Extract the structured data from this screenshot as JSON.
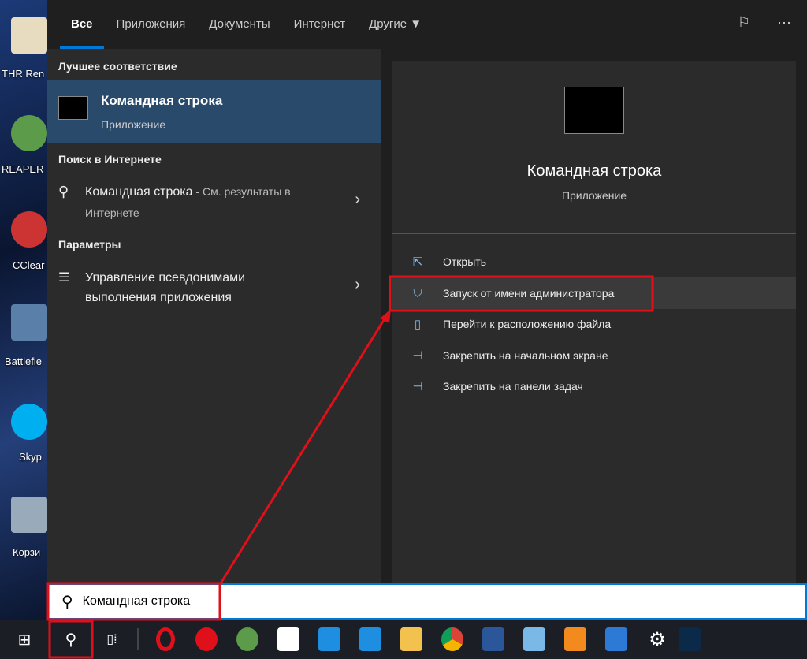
{
  "desktop": {
    "icons": [
      "THR Ren",
      "REAPER",
      "CClear",
      "Battlefie",
      "Skyp",
      "Корзи"
    ]
  },
  "tabs": [
    {
      "label": "Все",
      "active": true
    },
    {
      "label": "Приложения"
    },
    {
      "label": "Документы"
    },
    {
      "label": "Интернет"
    },
    {
      "label": "Другие"
    }
  ],
  "header_icons": [
    "feedback-icon",
    "more-icon"
  ],
  "left": {
    "best_match_heading": "Лучшее соответствие",
    "best_match": {
      "title": "Командная строка",
      "subtitle": "Приложение"
    },
    "web_heading": "Поиск в Интернете",
    "web_item": {
      "query": "Командная строка",
      "suffix": " - См. результаты в",
      "line2": "Интернете"
    },
    "settings_heading": "Параметры",
    "settings_item": {
      "line1": "Управление псевдонимами",
      "line2": "выполнения приложения"
    }
  },
  "right": {
    "title": "Командная строка",
    "subtitle": "Приложение",
    "actions": [
      {
        "label": "Открыть",
        "icon": "open-icon"
      },
      {
        "label": "Запуск от имени администратора",
        "icon": "shield-icon",
        "highlighted": true
      },
      {
        "label": "Перейти к расположению файла",
        "icon": "file-location-icon"
      },
      {
        "label": "Закрепить на начальном экране",
        "icon": "pin-icon"
      },
      {
        "label": "Закрепить на панели задач",
        "icon": "pin-icon"
      }
    ]
  },
  "search": {
    "value": "Командная строка"
  },
  "taskbar": {
    "apps": [
      "opera",
      "yandex",
      "reaper",
      "cursor-app",
      "mail",
      "l-app",
      "file-explorer",
      "chrome",
      "word",
      "control-panel",
      "sublime",
      "photos",
      "settings",
      "ps"
    ]
  },
  "colors": {
    "accent": "#0078d7",
    "annotation": "#e0101a",
    "selected": "#2a4a6b"
  }
}
